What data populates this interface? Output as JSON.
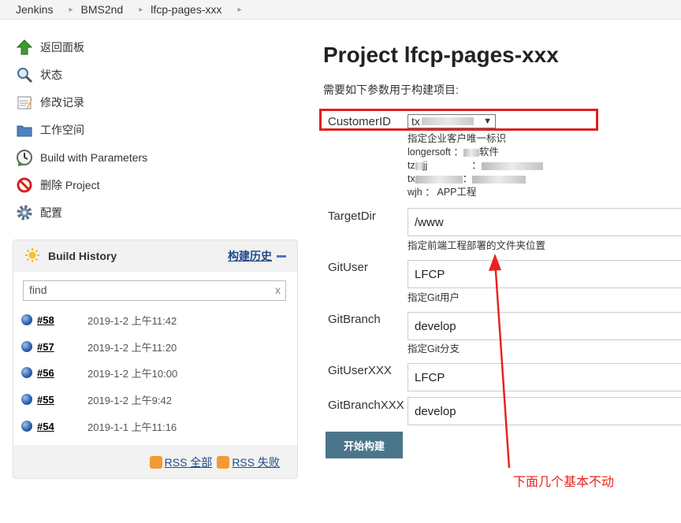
{
  "breadcrumb": [
    "Jenkins",
    "BMS2nd",
    "lfcp-pages-xxx"
  ],
  "sidebar": {
    "tasks": [
      {
        "label": "返回面板",
        "icon": "up-arrow-icon"
      },
      {
        "label": "状态",
        "icon": "search-icon"
      },
      {
        "label": "修改记录",
        "icon": "notepad-icon"
      },
      {
        "label": "工作空间",
        "icon": "folder-icon"
      },
      {
        "label": "Build with Parameters",
        "icon": "clock-icon"
      },
      {
        "label": "删除 Project",
        "icon": "no-entry-icon"
      },
      {
        "label": "配置",
        "icon": "gear-icon"
      }
    ]
  },
  "build_history": {
    "title": "Build History",
    "trend": "构建历史",
    "find_value": "find",
    "find_clear": "x",
    "builds": [
      {
        "number": "#58",
        "date": "2019-1-2 上午11:42"
      },
      {
        "number": "#57",
        "date": "2019-1-2 上午11:20"
      },
      {
        "number": "#56",
        "date": "2019-1-2 上午10:00"
      },
      {
        "number": "#55",
        "date": "2019-1-2 上午9:42"
      },
      {
        "number": "#54",
        "date": "2019-1-1 上午11:16"
      }
    ],
    "rss_all": "RSS 全部",
    "rss_fail": "RSS 失败"
  },
  "main": {
    "title": "Project lfcp-pages-xxx",
    "intro": "需要如下参数用于构建项目:",
    "customer_id": {
      "label": "CustomerID",
      "selected": "tx",
      "description": "指定企业客户唯一标识",
      "options_text": [
        "longersoft  ：",
        "软件",
        "tz",
        "jj",
        "：",
        "tx",
        "：",
        "wjh ： APP工程"
      ]
    },
    "target_dir": {
      "label": "TargetDir",
      "value": "/www",
      "description": "指定前端工程部署的文件夹位置"
    },
    "git_user": {
      "label": "GitUser",
      "value": "LFCP",
      "description": "指定Git用户"
    },
    "git_branch": {
      "label": "GitBranch",
      "value": "develop",
      "description": "指定Git分支"
    },
    "git_user_xxx": {
      "label": "GitUserXXX",
      "value": "LFCP"
    },
    "git_branch_xxx": {
      "label": "GitBranchXXX",
      "value": "develop"
    },
    "build_button": "开始构建"
  },
  "annotation": {
    "text": "下面几个基本不动",
    "color": "#e8231f"
  },
  "colors": {
    "accent": "#4b758b",
    "highlight": "#e0201e",
    "link": "#204a87"
  }
}
